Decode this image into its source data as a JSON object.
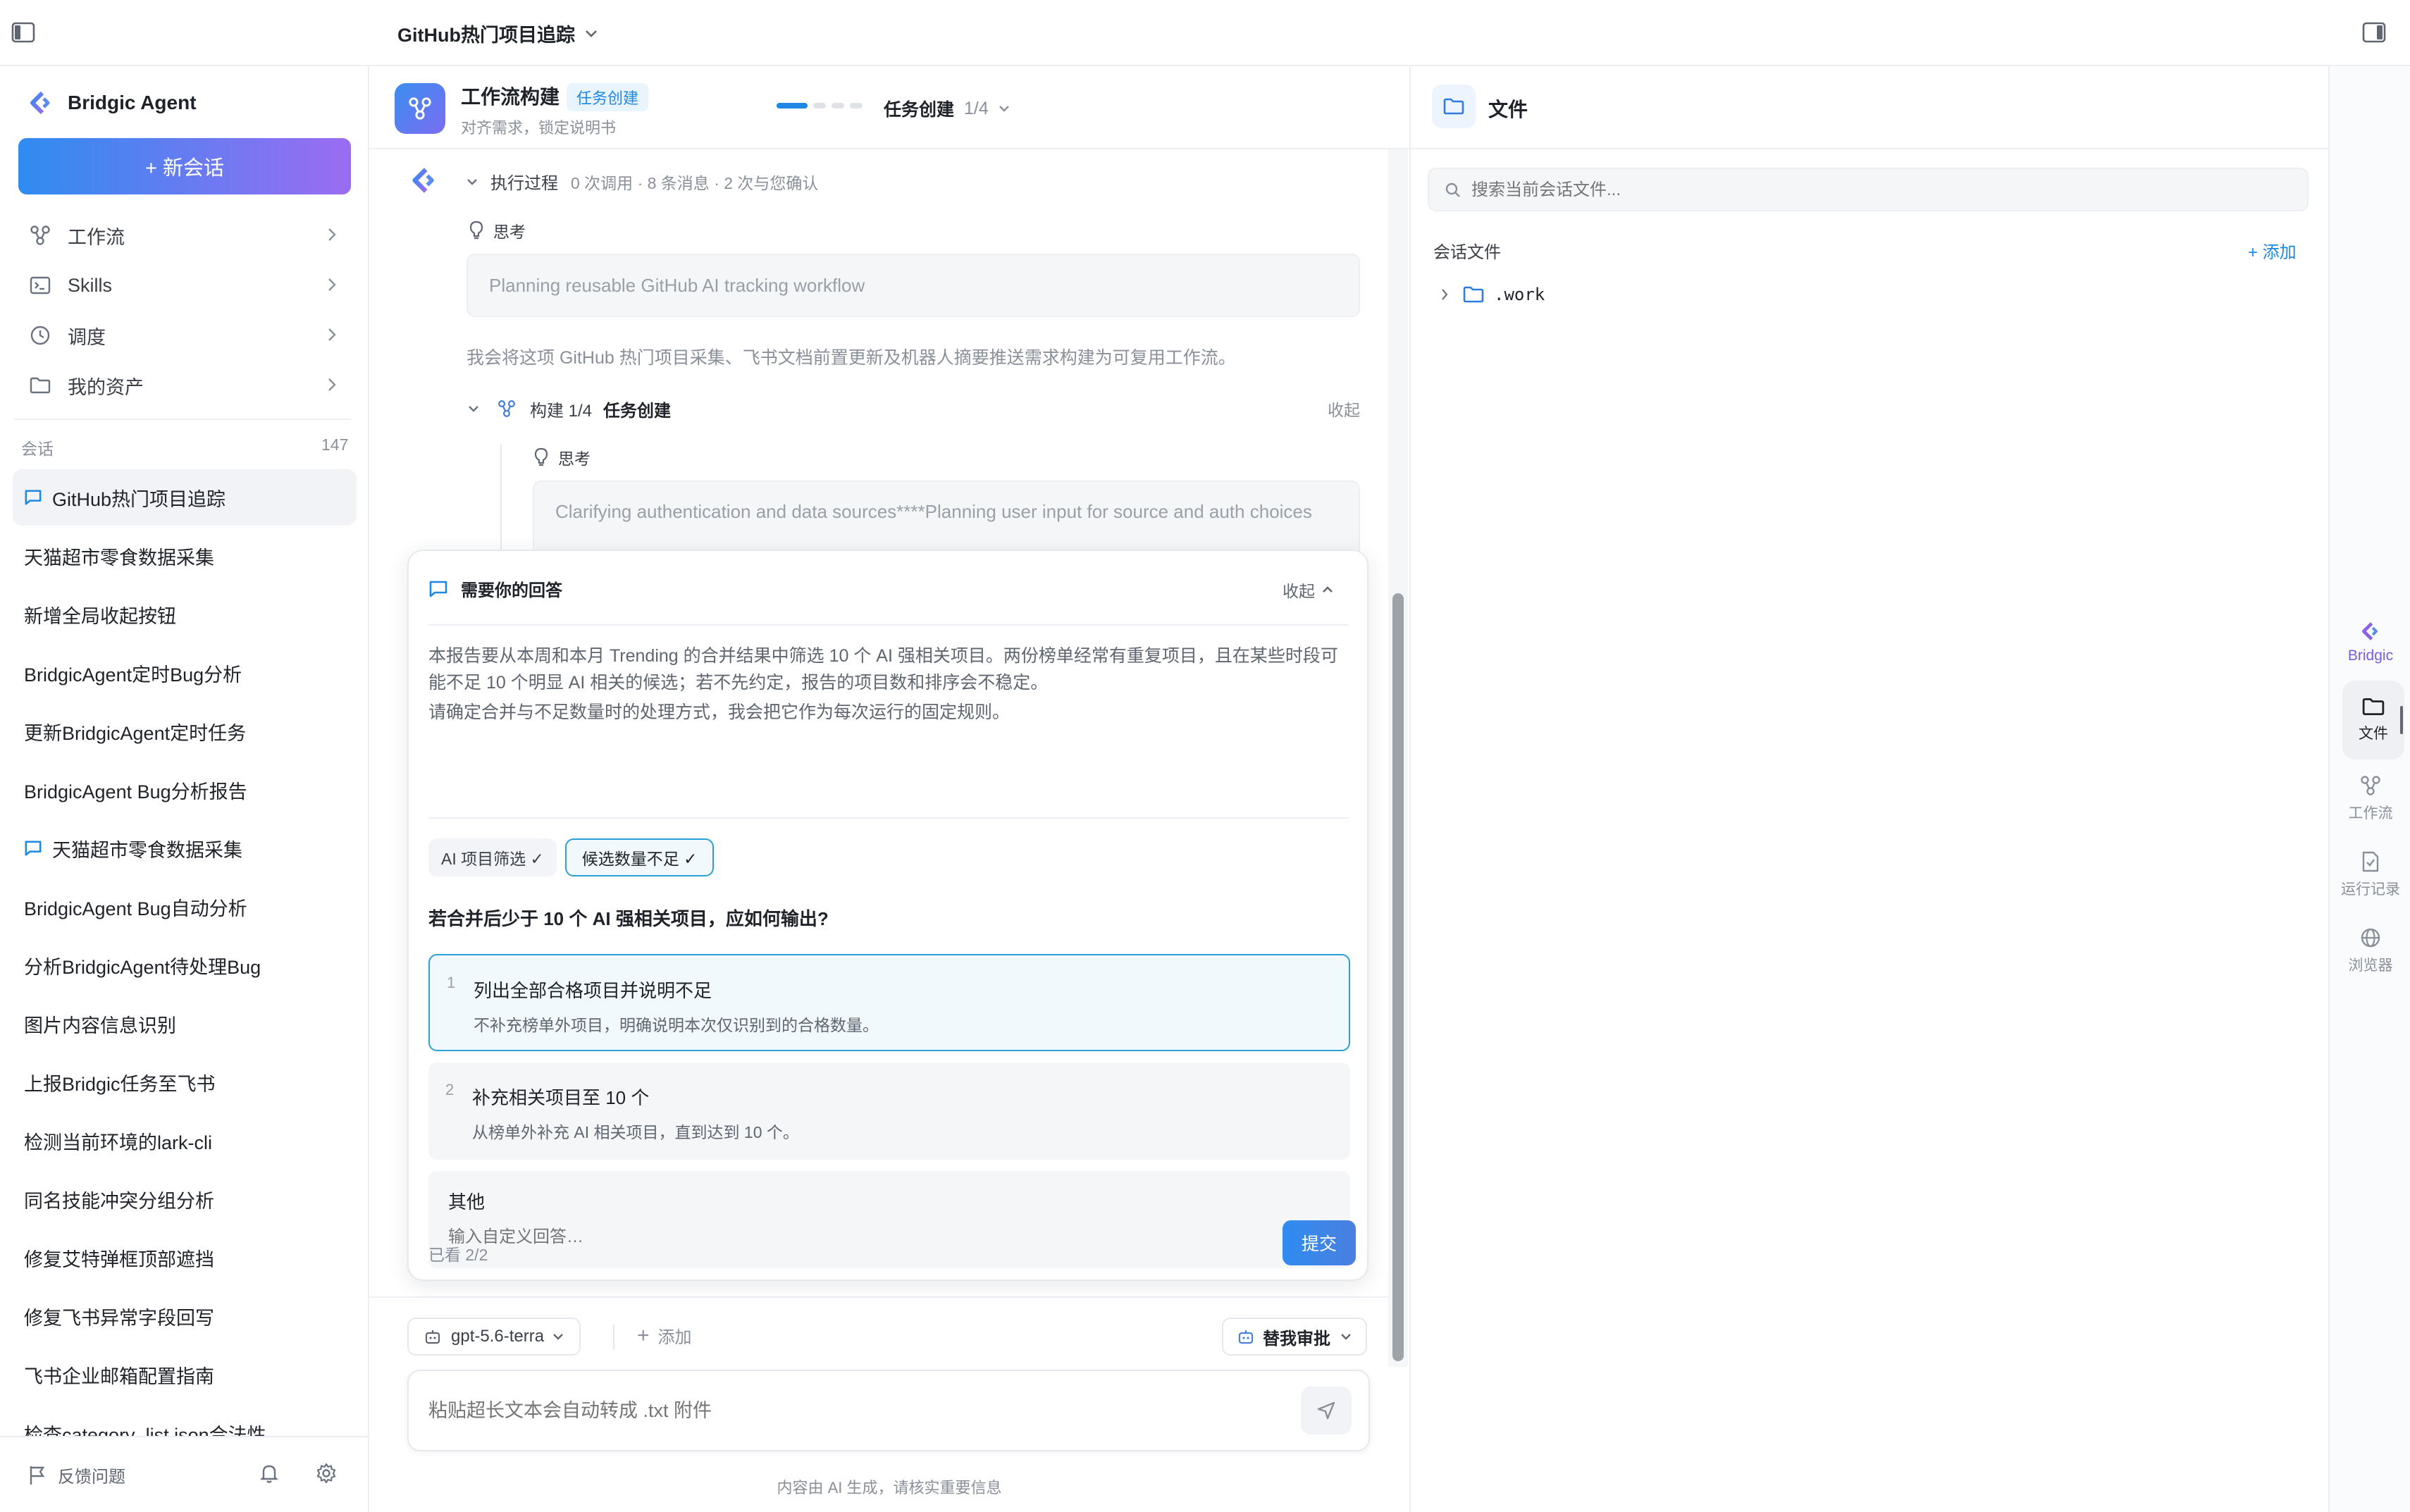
{
  "topbar": {
    "title": "GitHub热门项目追踪"
  },
  "sidebar": {
    "brand": "Bridgic Agent",
    "new_chat_label": "+ 新会话",
    "nav": [
      {
        "label": "工作流",
        "icon": "workflow-icon"
      },
      {
        "label": "Skills",
        "icon": "terminal-icon"
      },
      {
        "label": "调度",
        "icon": "clock-icon"
      },
      {
        "label": "我的资产",
        "icon": "folder-icon"
      }
    ],
    "conversations_label": "会话",
    "conversations_count": "147",
    "conversations": [
      {
        "title": "GitHub热门项目追踪",
        "active": true,
        "icon": true
      },
      {
        "title": "天猫超市零食数据采集",
        "active": false,
        "icon": false
      },
      {
        "title": "新增全局收起按钮",
        "active": false,
        "icon": false
      },
      {
        "title": "BridgicAgent定时Bug分析",
        "active": false,
        "icon": false
      },
      {
        "title": "更新BridgicAgent定时任务",
        "active": false,
        "icon": false
      },
      {
        "title": "BridgicAgent Bug分析报告",
        "active": false,
        "icon": false
      },
      {
        "title": "天猫超市零食数据采集",
        "active": false,
        "icon": true
      },
      {
        "title": "BridgicAgent Bug自动分析",
        "active": false,
        "icon": false
      },
      {
        "title": "分析BridgicAgent待处理Bug",
        "active": false,
        "icon": false
      },
      {
        "title": "图片内容信息识别",
        "active": false,
        "icon": false
      },
      {
        "title": "上报Bridgic任务至飞书",
        "active": false,
        "icon": false
      },
      {
        "title": "检测当前环境的lark-cli",
        "active": false,
        "icon": false
      },
      {
        "title": "同名技能冲突分组分析",
        "active": false,
        "icon": false
      },
      {
        "title": "修复艾特弹框顶部遮挡",
        "active": false,
        "icon": false
      },
      {
        "title": "修复飞书异常字段回写",
        "active": false,
        "icon": false
      },
      {
        "title": "飞书企业邮箱配置指南",
        "active": false,
        "icon": false
      },
      {
        "title": "检查category_list.json合法性",
        "active": false,
        "icon": false
      }
    ],
    "feedback_label": "反馈问题"
  },
  "chat": {
    "header": {
      "title": "工作流构建",
      "badge": "任务创建",
      "subtitle": "对齐需求，锁定说明书",
      "step_label": "任务创建",
      "step_count": "1/4",
      "progress_fraction": 0.25
    },
    "process": {
      "label": "执行过程",
      "meta": "0 次调用 · 8 条消息 · 2 次与您确认",
      "thinking_label": "思考",
      "thinking_text": "Planning reusable GitHub AI tracking workflow",
      "message": "我会将这项 GitHub 热门项目采集、飞书文档前置更新及机器人摘要推送需求构建为可复用工作流。",
      "build_label": "构建 1/4",
      "build_stage": "任务创建",
      "collapse_label": "收起",
      "sub_thinking_label": "思考",
      "sub_thinking_text": "Clarifying authentication and data sources****Planning user input for source and auth choices"
    },
    "question": {
      "title": "需要你的回答",
      "collapse_label": "收起",
      "intro_1": "本报告要从本周和本月 Trending 的合并结果中筛选 10 个 AI 强相关项目。两份榜单经常有重复项目，且在某些时段可能不足 10 个明显 AI 相关的候选；若不先约定，报告的项目数和排序会不稳定。",
      "intro_2": "请确定合并与不足数量时的处理方式，我会把它作为每次运行的固定规则。",
      "tabs": [
        {
          "label": "AI 项目筛选 ✓",
          "active": false
        },
        {
          "label": "候选数量不足 ✓",
          "active": true
        }
      ],
      "prompt": "若合并后少于 10 个 AI 强相关项目，应如何输出?",
      "options": [
        {
          "num": "1",
          "title": "列出全部合格项目并说明不足",
          "desc": "不补充榜单外项目，明确说明本次仅识别到的合格数量。",
          "selected": true
        },
        {
          "num": "2",
          "title": "补充相关项目至 10 个",
          "desc": "从榜单外补充 AI 相关项目，直到达到 10 个。",
          "selected": false
        }
      ],
      "other_label": "其他",
      "other_placeholder": "输入自定义回答…",
      "viewed": "已看 2/2",
      "submit_label": "提交"
    },
    "composer": {
      "model": "gpt-5.6-terra",
      "add_label": "添加",
      "approval_label": "替我审批",
      "placeholder": "粘贴超长文本会自动转成 .txt 附件",
      "disclaimer": "内容由 AI 生成，请核实重要信息"
    }
  },
  "files": {
    "title": "文件",
    "search_placeholder": "搜索当前会话文件...",
    "section_label": "会话文件",
    "add_label": "+ 添加",
    "tree": [
      {
        "name": ".work",
        "type": "folder"
      }
    ]
  },
  "rail": {
    "items": [
      {
        "label": "Bridgic",
        "icon": "bridgic-logo-icon",
        "active": false
      },
      {
        "label": "文件",
        "icon": "folder-icon",
        "active": true
      },
      {
        "label": "工作流",
        "icon": "workflow-icon",
        "active": false
      },
      {
        "label": "运行记录",
        "icon": "document-check-icon",
        "active": false
      },
      {
        "label": "浏览器",
        "icon": "globe-icon",
        "active": false
      }
    ]
  },
  "colors": {
    "accent": "#1e88e5",
    "brand_gradient_start": "#2f8cf0",
    "brand_gradient_end": "#9b6cf2",
    "selected_border": "#2aa0d8",
    "selected_bg": "#f1f9fd"
  }
}
